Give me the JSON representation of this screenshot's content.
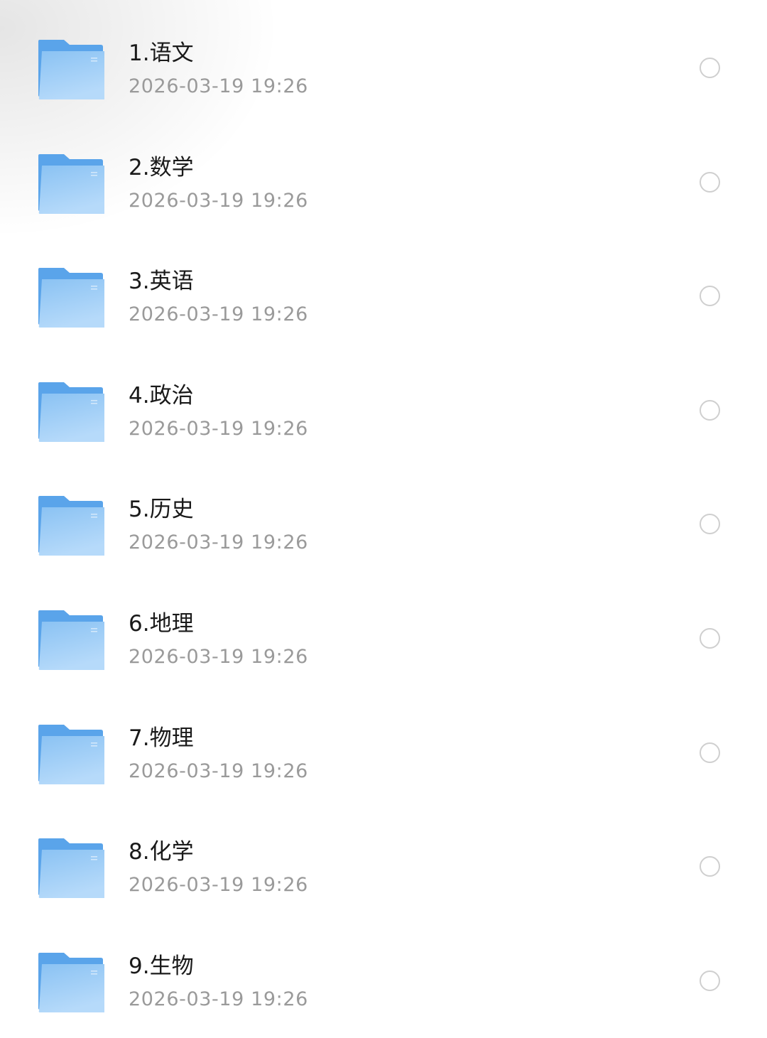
{
  "files": [
    {
      "name": "1.语文",
      "date": "2026-03-19 19:26"
    },
    {
      "name": "2.数学",
      "date": "2026-03-19 19:26"
    },
    {
      "name": "3.英语",
      "date": "2026-03-19 19:26"
    },
    {
      "name": "4.政治",
      "date": "2026-03-19 19:26"
    },
    {
      "name": "5.历史",
      "date": "2026-03-19 19:26"
    },
    {
      "name": "6.地理",
      "date": "2026-03-19 19:26"
    },
    {
      "name": "7.物理",
      "date": "2026-03-19 19:26"
    },
    {
      "name": "8.化学",
      "date": "2026-03-19 19:26"
    },
    {
      "name": "9.生物",
      "date": "2026-03-19 19:26"
    }
  ],
  "icons": {
    "item_icon": "folder-icon",
    "select_icon": "radio-unchecked-icon"
  },
  "colors": {
    "folder_back": "#5aa4ea",
    "folder_front_top": "#8ac2f3",
    "folder_front_bottom": "#b6dafa",
    "name_text": "#1a1a1a",
    "date_text": "#9a9a9a",
    "radio_border": "#cfcfcf"
  }
}
